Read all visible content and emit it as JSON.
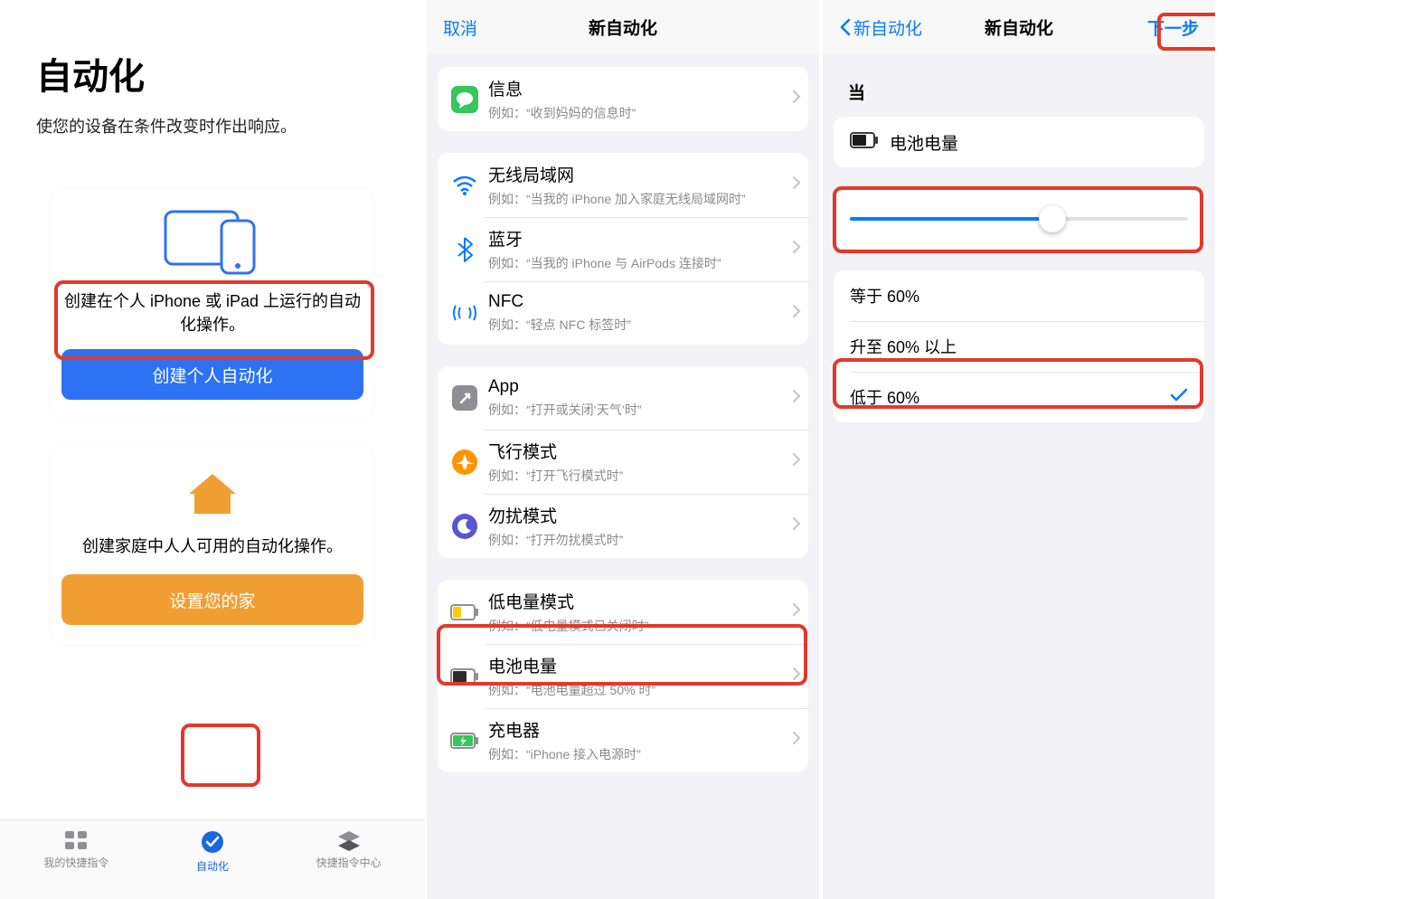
{
  "phone1": {
    "title": "自动化",
    "subtitle": "使您的设备在条件改变时作出响应。",
    "card1": {
      "description": "创建在个人 iPhone 或 iPad 上运行的自动化操作。",
      "button": "创建个人自动化"
    },
    "card2": {
      "description": "创建家庭中人人可用的自动化操作。",
      "button": "设置您的家"
    },
    "tabs": {
      "shortcuts": "我的快捷指令",
      "automation": "自动化",
      "gallery": "快捷指令中心"
    }
  },
  "phone2": {
    "cancel": "取消",
    "title": "新自动化",
    "rows": {
      "messages": {
        "title": "信息",
        "sub": "例如：“收到妈妈的信息时”"
      },
      "wifi": {
        "title": "无线局域网",
        "sub": "例如：“当我的 iPhone 加入家庭无线局域网时”"
      },
      "bluetooth": {
        "title": "蓝牙",
        "sub": "例如：“当我的 iPhone 与 AirPods 连接时”"
      },
      "nfc": {
        "title": "NFC",
        "sub": "例如：“轻点 NFC 标签时”"
      },
      "app": {
        "title": "App",
        "sub": "例如：“打开或关闭‘天气’时”"
      },
      "airplane": {
        "title": "飞行模式",
        "sub": "例如：“打开飞行模式时”"
      },
      "dnd": {
        "title": "勿扰模式",
        "sub": "例如：“打开勿扰模式时”"
      },
      "lowpower": {
        "title": "低电量模式",
        "sub": "例如：“低电量模式已关闭时”"
      },
      "battery": {
        "title": "电池电量",
        "sub": "例如：“电池电量超过 50% 时”"
      },
      "charger": {
        "title": "充电器",
        "sub": "例如：“iPhone 接入电源时”"
      }
    }
  },
  "phone3": {
    "back": "新自动化",
    "title": "新自动化",
    "next": "下一步",
    "section_when": "当",
    "trigger_label": "电池电量",
    "slider_percent": 60,
    "conditions": {
      "equals": "等于 60%",
      "rises": "升至 60% 以上",
      "falls": "低于 60%"
    },
    "selected_condition": "falls"
  }
}
